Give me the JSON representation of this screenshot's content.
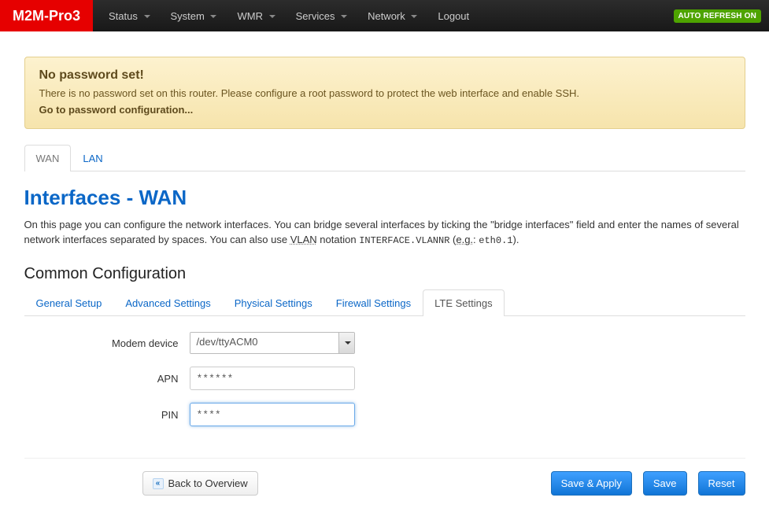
{
  "brand": "M2M-Pro3",
  "nav": {
    "items": [
      {
        "label": "Status",
        "has_menu": true
      },
      {
        "label": "System",
        "has_menu": true
      },
      {
        "label": "WMR",
        "has_menu": true
      },
      {
        "label": "Services",
        "has_menu": true
      },
      {
        "label": "Network",
        "has_menu": true
      },
      {
        "label": "Logout",
        "has_menu": false
      }
    ],
    "auto_refresh": "AUTO REFRESH ON"
  },
  "alert": {
    "title": "No password set!",
    "text": "There is no password set on this router. Please configure a root password to protect the web interface and enable SSH.",
    "link": "Go to password configuration..."
  },
  "iface_tabs": [
    {
      "label": "WAN",
      "active": true
    },
    {
      "label": "LAN",
      "active": false
    }
  ],
  "page": {
    "title": "Interfaces - WAN",
    "desc_pre": "On this page you can configure the network interfaces. You can bridge several interfaces by ticking the \"bridge interfaces\" field and enter the names of several network interfaces separated by spaces. You can also use ",
    "vlan_abbr": "VLAN",
    "desc_mid": " notation ",
    "code1": "INTERFACE.VLANNR",
    "desc_open": " (",
    "eg_abbr": "e.g.",
    "desc_colon": ": ",
    "code2": "eth0.1",
    "desc_close": ")."
  },
  "section": {
    "title": "Common Configuration"
  },
  "config_tabs": [
    {
      "label": "General Setup",
      "active": false
    },
    {
      "label": "Advanced Settings",
      "active": false
    },
    {
      "label": "Physical Settings",
      "active": false
    },
    {
      "label": "Firewall Settings",
      "active": false
    },
    {
      "label": "LTE Settings",
      "active": true
    }
  ],
  "form": {
    "modem_label": "Modem device",
    "modem_value": "/dev/ttyACM0",
    "apn_label": "APN",
    "apn_value": "******",
    "pin_label": "PIN",
    "pin_value": "****"
  },
  "actions": {
    "back": "Back to Overview",
    "save_apply": "Save & Apply",
    "save": "Save",
    "reset": "Reset"
  }
}
